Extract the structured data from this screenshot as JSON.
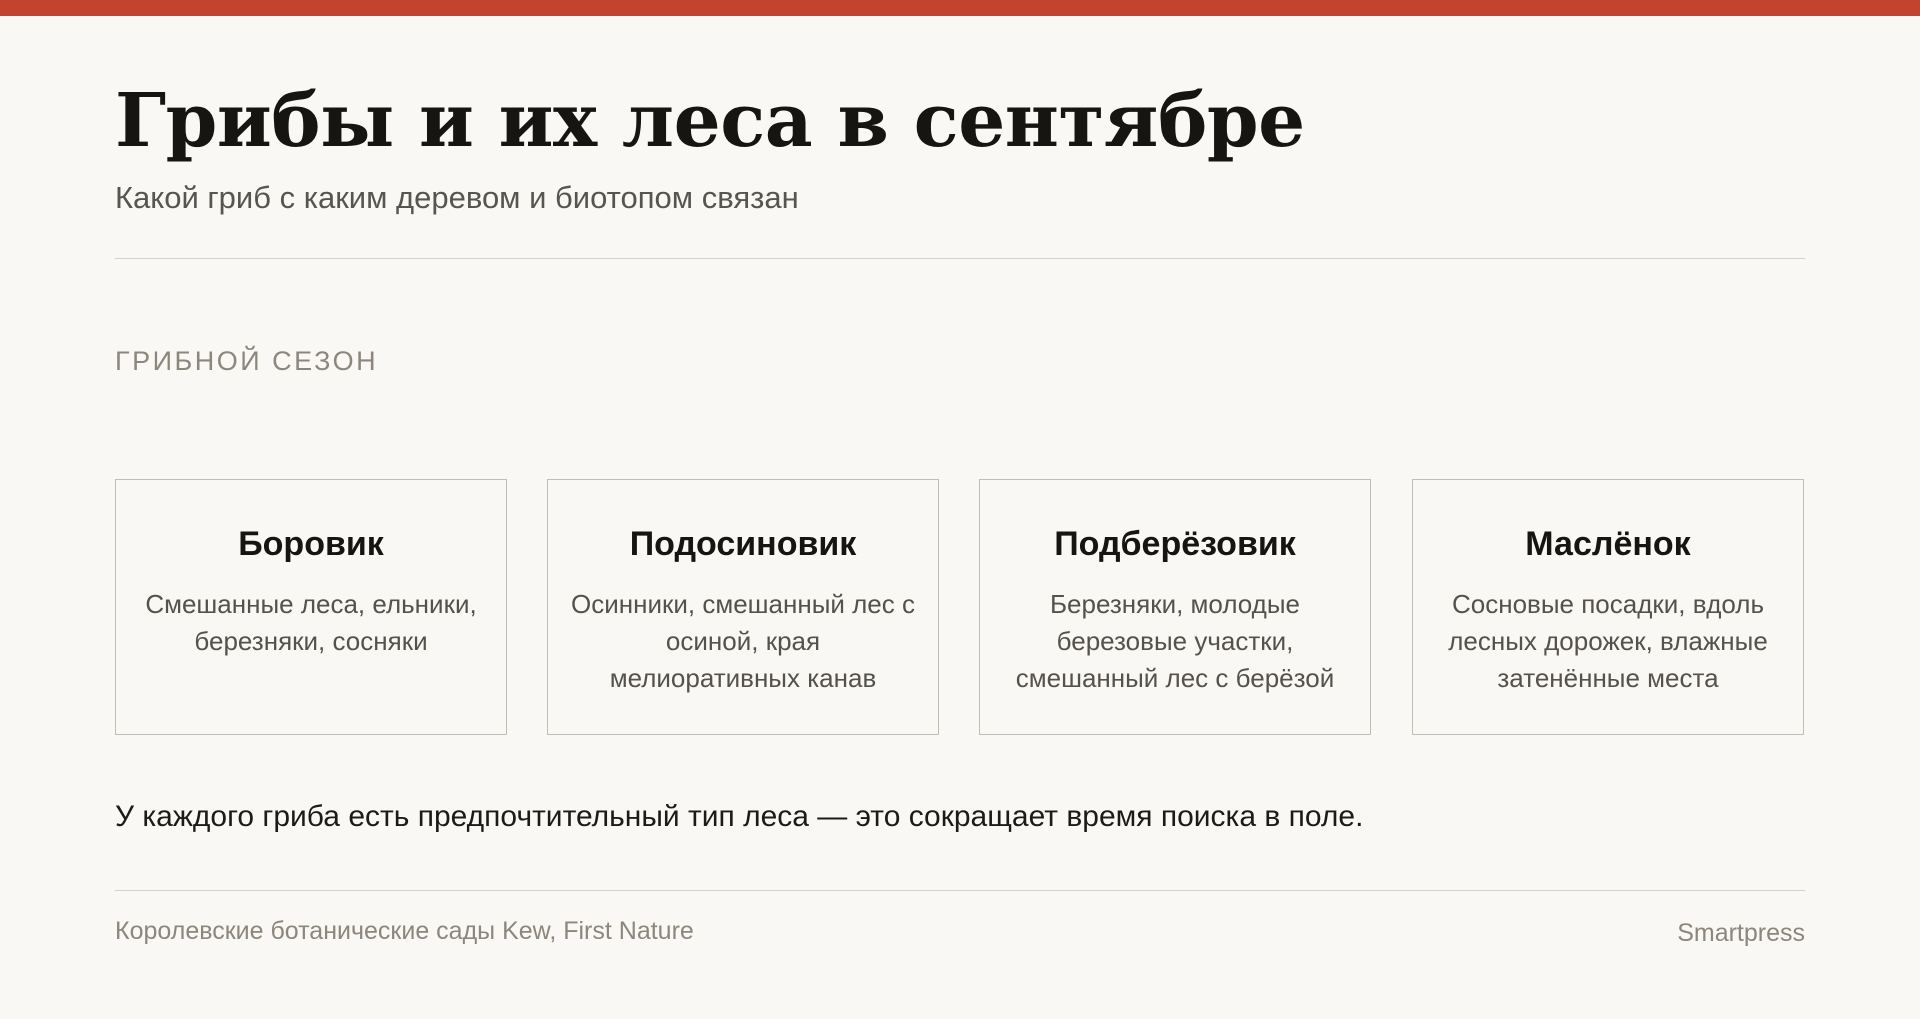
{
  "header": {
    "title": "Грибы и их леса в сентябре",
    "subtitle": "Какой гриб с каким деревом и биотопом связан"
  },
  "section": {
    "label": "ГРИБНОЙ СЕЗОН"
  },
  "cards": [
    {
      "name": "Боровик",
      "habitat": "Смешанные леса, ельники, березняки, сосняки"
    },
    {
      "name": "Подосиновик",
      "habitat": "Осинники, смешанный лес с осиной, края мелиоративных канав"
    },
    {
      "name": "Подберёзовик",
      "habitat": "Березняки, молодые березовые участки, смешанный лес с берёзой"
    },
    {
      "name": "Маслёнок",
      "habitat": "Сосновые посадки, вдоль лесных дорожек, влажные затенённые места"
    }
  ],
  "note": "У каждого гриба есть предпочтительный тип леса — это сокращает время поиска в поле.",
  "footer": {
    "source": "Королевские ботанические сады Kew, First Nature",
    "brand": "Smartpress"
  },
  "colors": {
    "accent": "#c4432f",
    "background": "#faf8f4",
    "text": "#161512",
    "muted": "#8c867c"
  }
}
